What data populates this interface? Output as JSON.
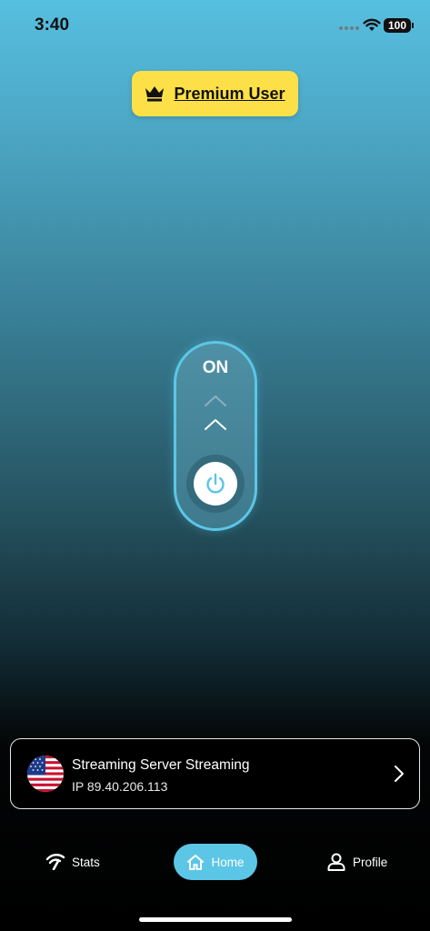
{
  "status_bar": {
    "time": "3:40",
    "battery": "100"
  },
  "premium": {
    "label": "Premium User",
    "icon": "crown-icon"
  },
  "vpn_toggle": {
    "state_label": "ON",
    "accent": "#5cc6e6"
  },
  "server": {
    "name": "Streaming Server Streaming",
    "ip": "IP 89.40.206.113",
    "flag": "us-flag-icon"
  },
  "tabs": [
    {
      "label": "Stats",
      "icon": "stats-icon",
      "active": false
    },
    {
      "label": "Home",
      "icon": "home-icon",
      "active": true
    },
    {
      "label": "Profile",
      "icon": "profile-icon",
      "active": false
    }
  ],
  "colors": {
    "premium_bg": "#fde047",
    "accent": "#5cc6e6"
  }
}
